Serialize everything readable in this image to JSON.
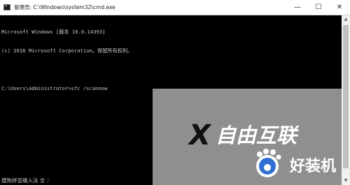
{
  "window": {
    "title": "管理员: C:\\Windows\\system32\\cmd.exe",
    "minimize_glyph": "—",
    "maximize_glyph": "☐",
    "close_glyph": "✕"
  },
  "console": {
    "lines": [
      "Microsoft Windows [版本 10.0.14393]",
      "(c) 2016 Microsoft Corporation。保留所有权利。",
      "",
      "C:\\Users\\Administrator>sfc /scannow"
    ]
  },
  "ime": {
    "status": "搜狗拼音输入法 全 ："
  },
  "scrollbar": {
    "up_glyph": "▲",
    "down_glyph": "▼"
  },
  "watermark": {
    "main_glyph": "X",
    "main_text": "自由互联",
    "sub_text": "好装机"
  },
  "colors": {
    "console_bg": "#000000",
    "console_text": "#c8c8c8",
    "titlebar_bg": "#ffffff",
    "overlay": "#8f8f8f"
  }
}
